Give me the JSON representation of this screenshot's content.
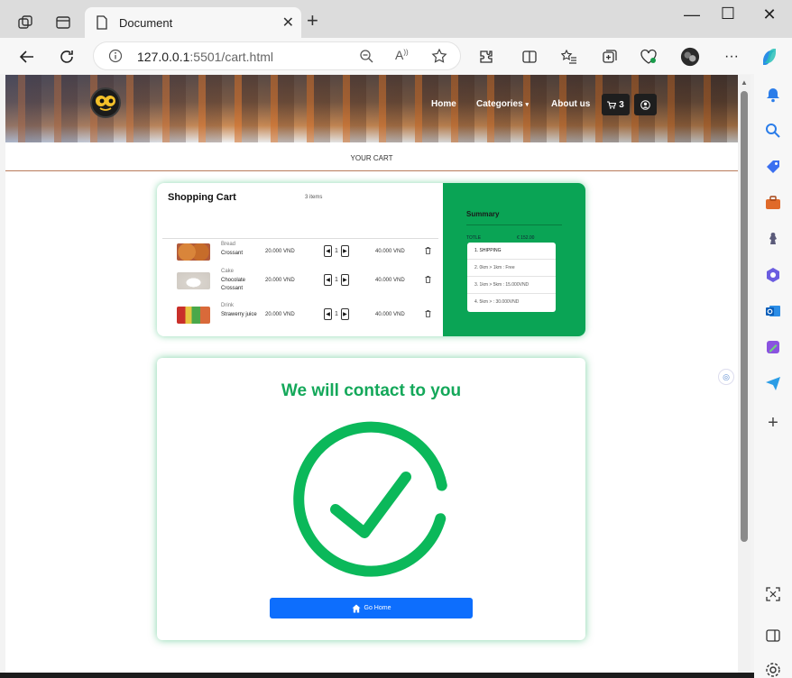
{
  "browser": {
    "tab_title": "Document",
    "url_host": "127.0.0.1",
    "url_rest": ":5501/cart.html"
  },
  "site": {
    "nav": {
      "home": "Home",
      "categories": "Categories",
      "about": "About us",
      "cart_count": "3"
    },
    "page_heading": "YOUR CART"
  },
  "cart": {
    "title": "Shopping Cart",
    "count_label": "3 items",
    "items": [
      {
        "category": "Bread",
        "name": "Crossant",
        "price": "20.000 VND",
        "qty": "1",
        "total": "40.000 VND"
      },
      {
        "category": "Cake",
        "name": "Chocolate Crossant",
        "price": "20.000 VND",
        "qty": "1",
        "total": "40.000 VND"
      },
      {
        "category": "Drink",
        "name": "Strawerry juice",
        "price": "20.000 VND",
        "qty": "1",
        "total": "40.000 VND"
      }
    ]
  },
  "summary": {
    "title": "Summary",
    "total_label": "TOTLE",
    "total_value": "€ 152.00",
    "shipping": [
      "1. SHIPPING",
      "2. 0km > 1km : Free",
      "3. 1km > 5km : 15.000VND",
      "4. 5km > : 30.000VND"
    ]
  },
  "contact": {
    "title": "We will contact to you",
    "button": "Go Home"
  },
  "colors": {
    "accent_green": "#0aa455",
    "button_blue": "#0d6efd"
  }
}
